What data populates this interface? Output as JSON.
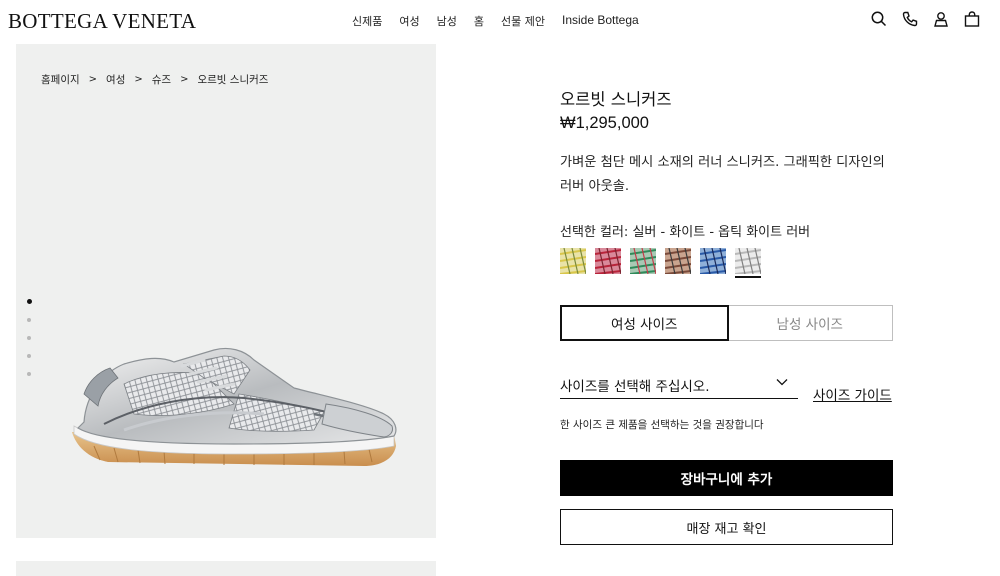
{
  "header": {
    "logo": "BOTTEGA VENETA",
    "nav": [
      "신제품",
      "여성",
      "남성",
      "홈",
      "선물 제안",
      "Inside Bottega"
    ],
    "icons": [
      "search-icon",
      "phone-icon",
      "account-icon",
      "shopping-bag-icon"
    ]
  },
  "breadcrumb": {
    "items": [
      "홈페이지",
      "여성",
      "슈즈",
      "오르빗 스니커즈"
    ],
    "separator": ">"
  },
  "gallery": {
    "dots": 5,
    "active_index": 0
  },
  "product": {
    "title": "오르빗 스니커즈",
    "price": "₩1,295,000",
    "description": "가벼운 첨단 메시 소재의 러너 스니커즈. 그래픽한 디자인의 러버 아웃솔.",
    "color_label": "선택한 컬러: 실버 - 화이트 - 옵틱 화이트 러버",
    "swatches": [
      {
        "name": "yellow-multi",
        "colors": [
          "#d8c64a",
          "#7a8a3a",
          "#e9e3a8"
        ]
      },
      {
        "name": "red-multi",
        "colors": [
          "#b8243a",
          "#7b2430",
          "#d9899a"
        ]
      },
      {
        "name": "green-multi",
        "colors": [
          "#2f8a5a",
          "#c43a4a",
          "#a8c9b4"
        ]
      },
      {
        "name": "brown-multi",
        "colors": [
          "#7a4a3a",
          "#3a3a3a",
          "#c9a48f"
        ]
      },
      {
        "name": "blue-multi",
        "colors": [
          "#2a5aa8",
          "#1a2a5a",
          "#8fb0d9"
        ]
      },
      {
        "name": "silver-white",
        "colors": [
          "#b8b8b8",
          "#808080",
          "#ececec"
        ]
      }
    ],
    "selected_swatch": 5
  },
  "sizes": {
    "tabs": [
      "여성 사이즈",
      "남성 사이즈"
    ],
    "active_tab": 0,
    "select_placeholder": "사이즈를 선택해 주십시오.",
    "guide_link": "사이즈 가이드",
    "recommendation": "한 사이즈 큰 제품을 선택하는 것을 권장합니다"
  },
  "actions": {
    "add_to_cart": "장바구니에 추가",
    "store_check": "매장 재고 확인"
  }
}
